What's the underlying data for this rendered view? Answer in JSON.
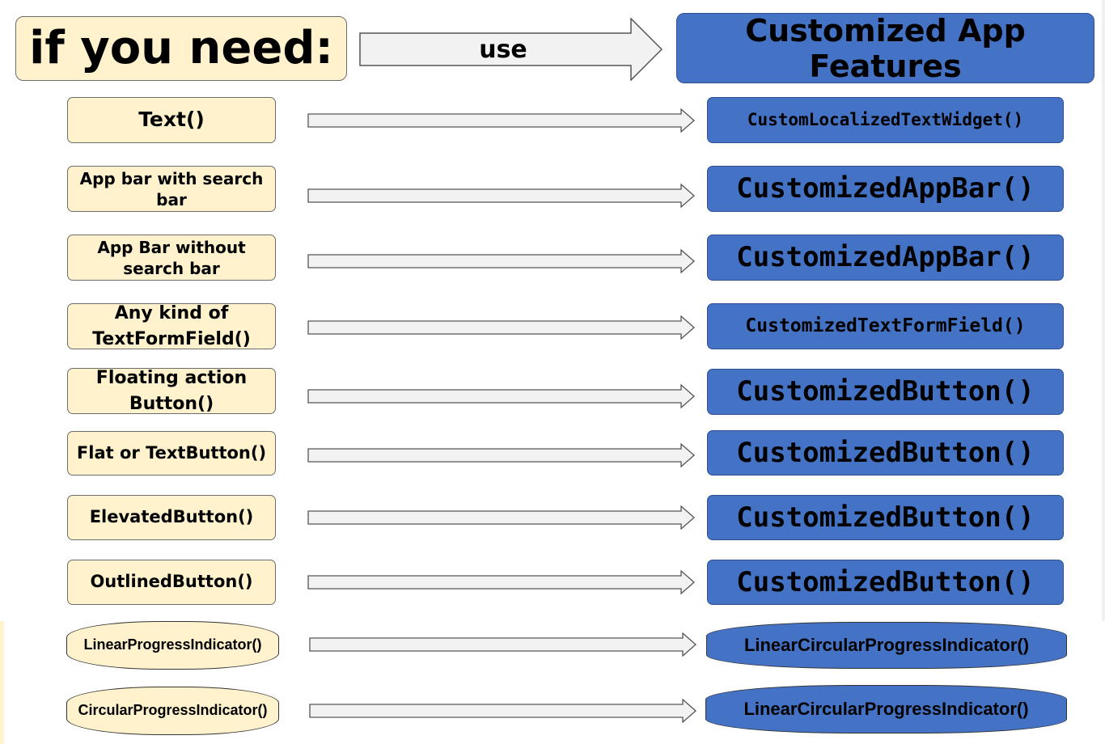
{
  "header": {
    "need_label": "if you need:",
    "use_label": "use",
    "features_label": "Customized App Features"
  },
  "rows": [
    {
      "need": "Text()",
      "use": "CustomLocalizedTextWidget()"
    },
    {
      "need": "App bar with search bar",
      "use": "CustomizedAppBar()"
    },
    {
      "need": "App Bar without search bar",
      "use": "CustomizedAppBar()"
    },
    {
      "need": "Any kind of TextFormField()",
      "use": "CustomizedTextFormField()"
    },
    {
      "need": "Floating action Button()",
      "use": "CustomizedButton()"
    },
    {
      "need": "Flat or TextButton()",
      "use": "CustomizedButton()"
    },
    {
      "need": "ElevatedButton()",
      "use": "CustomizedButton()"
    },
    {
      "need": "OutlinedButton()",
      "use": "CustomizedButton()"
    },
    {
      "need": "LinearProgressIndicator()",
      "use": "LinearCircularProgressIndicator()"
    },
    {
      "need": "CircularProgressIndicator()",
      "use": "LinearCircularProgressIndicator()"
    }
  ],
  "colors": {
    "need_fill": "#fff2cc",
    "feature_fill": "#4472c4",
    "arrow_fill": "#f2f2f2"
  }
}
